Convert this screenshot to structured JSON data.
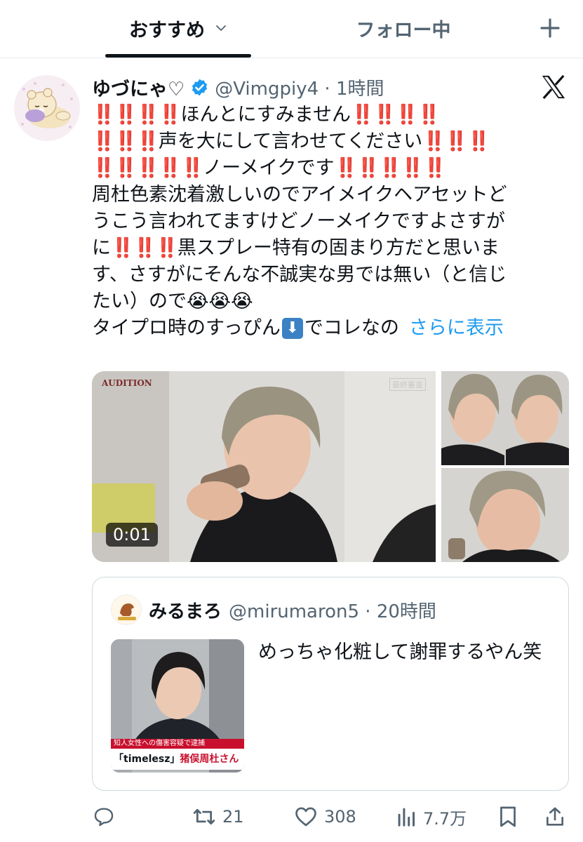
{
  "tabs": {
    "recommended": "おすすめ",
    "following": "フォロー中"
  },
  "tweet": {
    "display_name": "ゆづにゃ♡",
    "handle_time": "@Vimgpiy4 · 1時間",
    "lines": {
      "l1_bangs_a": "‼️‼️‼️‼️",
      "l1_text": "ほんとにすみません",
      "l1_bangs_b": "‼️‼️‼️‼️",
      "l2_bangs_a": "‼️‼️‼️",
      "l2_text": "声を大にして言わせてください",
      "l2_bangs_b": "‼️‼️‼️",
      "l3_bangs_a": "‼️‼️‼️‼️‼️",
      "l3_text": "ノーメイクです",
      "l3_bangs_b": "‼️‼️‼️‼️‼️",
      "l4": "周杜色素沈着激しいのでアイメイクヘアセットど",
      "l5": "うこう言われてますけどノーメイクですよさすが",
      "l6_pre": "に",
      "l6_bangs": "‼️‼️‼️",
      "l6_text": "黒スプレー特有の固まり方だと思いま",
      "l7": "す、さすがにそんな不誠実な男では無い（と信じ",
      "l8": "たい）ので😭😭😭",
      "l9_pre": "タイプロ時のすっぴん",
      "l9_emoji": "⬇",
      "l9_post": "でコレなの",
      "show_more": "さらに表示"
    },
    "video_time": "0:01",
    "video_logo": "AUDITION",
    "video_tag": "最終審査"
  },
  "quote": {
    "name": "みるまろ",
    "handle_time": "@mirumaron5 · 20時間",
    "text": "めっちゃ化粧して謝罪するやん笑",
    "ticker_red": "知人女性への傷害容疑で逮捕",
    "ticker_group": "「timelesz」",
    "ticker_name": "猪俣周杜さん"
  },
  "actions": {
    "retweets": "21",
    "likes": "308",
    "views": "7.7万"
  },
  "colors": {
    "accent": "#1d9bf0",
    "secondary_text": "#536471",
    "bang_red": "#e0245e"
  }
}
